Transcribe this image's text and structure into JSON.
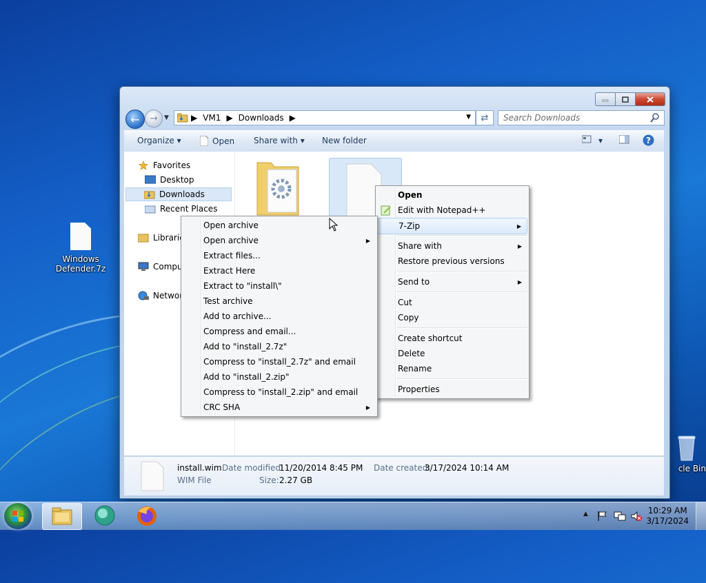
{
  "desktop": {
    "icons": [
      {
        "label": "Windows Defender.7z"
      },
      {
        "label": "cle Bin"
      }
    ]
  },
  "window": {
    "address": {
      "segments": [
        "VM1",
        "Downloads"
      ]
    },
    "search": {
      "placeholder": "Search Downloads"
    },
    "toolbar": {
      "organize": "Organize",
      "open": "Open",
      "share_with": "Share with",
      "new_folder": "New folder"
    },
    "nav": {
      "favorites": "Favorites",
      "desktop": "Desktop",
      "downloads": "Downloads",
      "recent": "Recent Places",
      "libraries": "Libraries",
      "computer": "Comput",
      "network": "Network"
    },
    "details": {
      "filename": "install.wim",
      "filetype": "WIM File",
      "date_modified_label": "Date modified:",
      "date_modified": "11/20/2014 8:45 PM",
      "size_label": "Size:",
      "size": "2.27 GB",
      "date_created_label": "Date created:",
      "date_created": "3/17/2024 10:14 AM"
    }
  },
  "context_menu": {
    "open": "Open",
    "edit_notepad": "Edit with Notepad++",
    "sevenzip": "7-Zip",
    "share_with": "Share with",
    "restore": "Restore previous versions",
    "send_to": "Send to",
    "cut": "Cut",
    "copy": "Copy",
    "create_shortcut": "Create shortcut",
    "delete": "Delete",
    "rename": "Rename",
    "properties": "Properties"
  },
  "sevenzip_menu": {
    "items": [
      "Open archive",
      "Open archive",
      "Extract files...",
      "Extract Here",
      "Extract to \"install\\\"",
      "Test archive",
      "Add to archive...",
      "Compress and email...",
      "Add to \"install_2.7z\"",
      "Compress to \"install_2.7z\" and email",
      "Add to \"install_2.zip\"",
      "Compress to \"install_2.zip\" and email",
      "CRC SHA"
    ]
  },
  "taskbar": {
    "clock_time": "10:29 AM",
    "clock_date": "3/17/2024"
  }
}
